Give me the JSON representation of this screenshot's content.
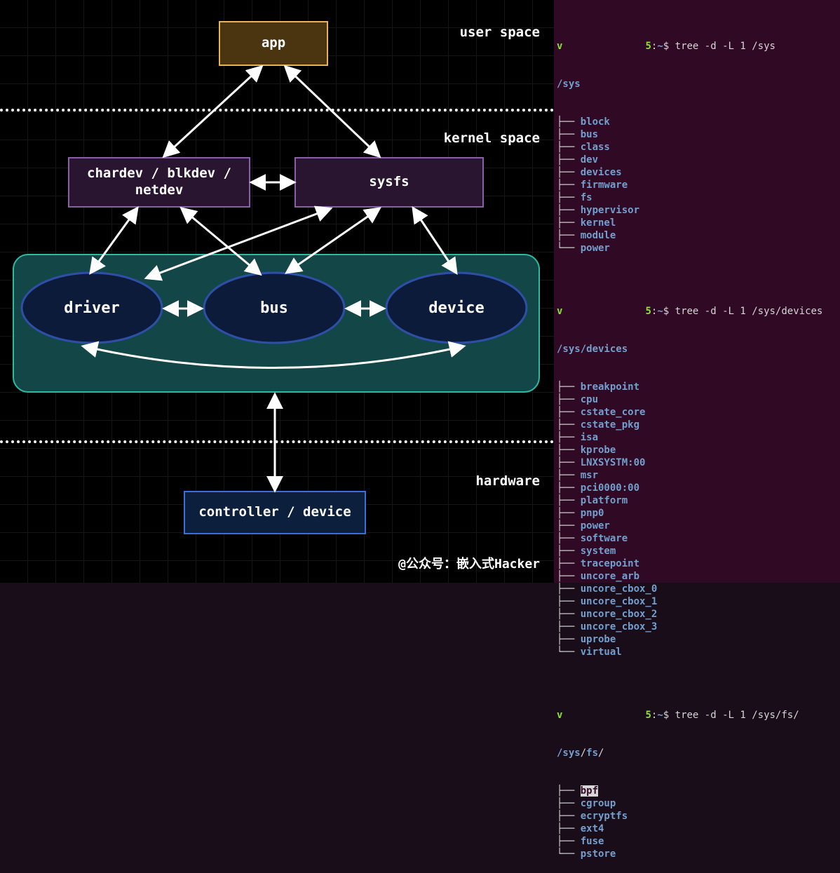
{
  "diagram": {
    "labels": {
      "user_space": "user space",
      "kernel_space": "kernel space",
      "hardware": "hardware"
    },
    "boxes": {
      "app": "app",
      "chardev": "chardev / blkdev / netdev",
      "sysfs": "sysfs",
      "driver": "driver",
      "bus": "bus",
      "device": "device",
      "controller": "controller / device"
    },
    "credit": "@公众号：嵌入式Hacker"
  },
  "term": {
    "user_letter": "v",
    "host_digit": "5",
    "tilde": "~",
    "prompt_dollar": "$",
    "cmd1": "tree -d -L 1 /sys",
    "root1": "/sys",
    "list1": [
      "block",
      "bus",
      "class",
      "dev",
      "devices",
      "firmware",
      "fs",
      "hypervisor",
      "kernel",
      "module",
      "power"
    ],
    "cmd2": "tree -d -L 1 /sys/devices",
    "root2": "/sys/devices",
    "list2": [
      "breakpoint",
      "cpu",
      "cstate_core",
      "cstate_pkg",
      "isa",
      "kprobe",
      "LNXSYSTM:00",
      "msr",
      "pci0000:00",
      "platform",
      "pnp0",
      "power",
      "software",
      "system",
      "tracepoint",
      "uncore_arb",
      "uncore_cbox_0",
      "uncore_cbox_1",
      "uncore_cbox_2",
      "uncore_cbox_3",
      "uprobe",
      "virtual"
    ],
    "cmd3": "tree -d -L 1 /sys/fs/",
    "root3_parts": [
      "/sys",
      "/",
      "fs",
      "/"
    ],
    "list3": [
      "bpf",
      "cgroup",
      "ecryptfs",
      "ext4",
      "fuse",
      "pstore"
    ]
  }
}
